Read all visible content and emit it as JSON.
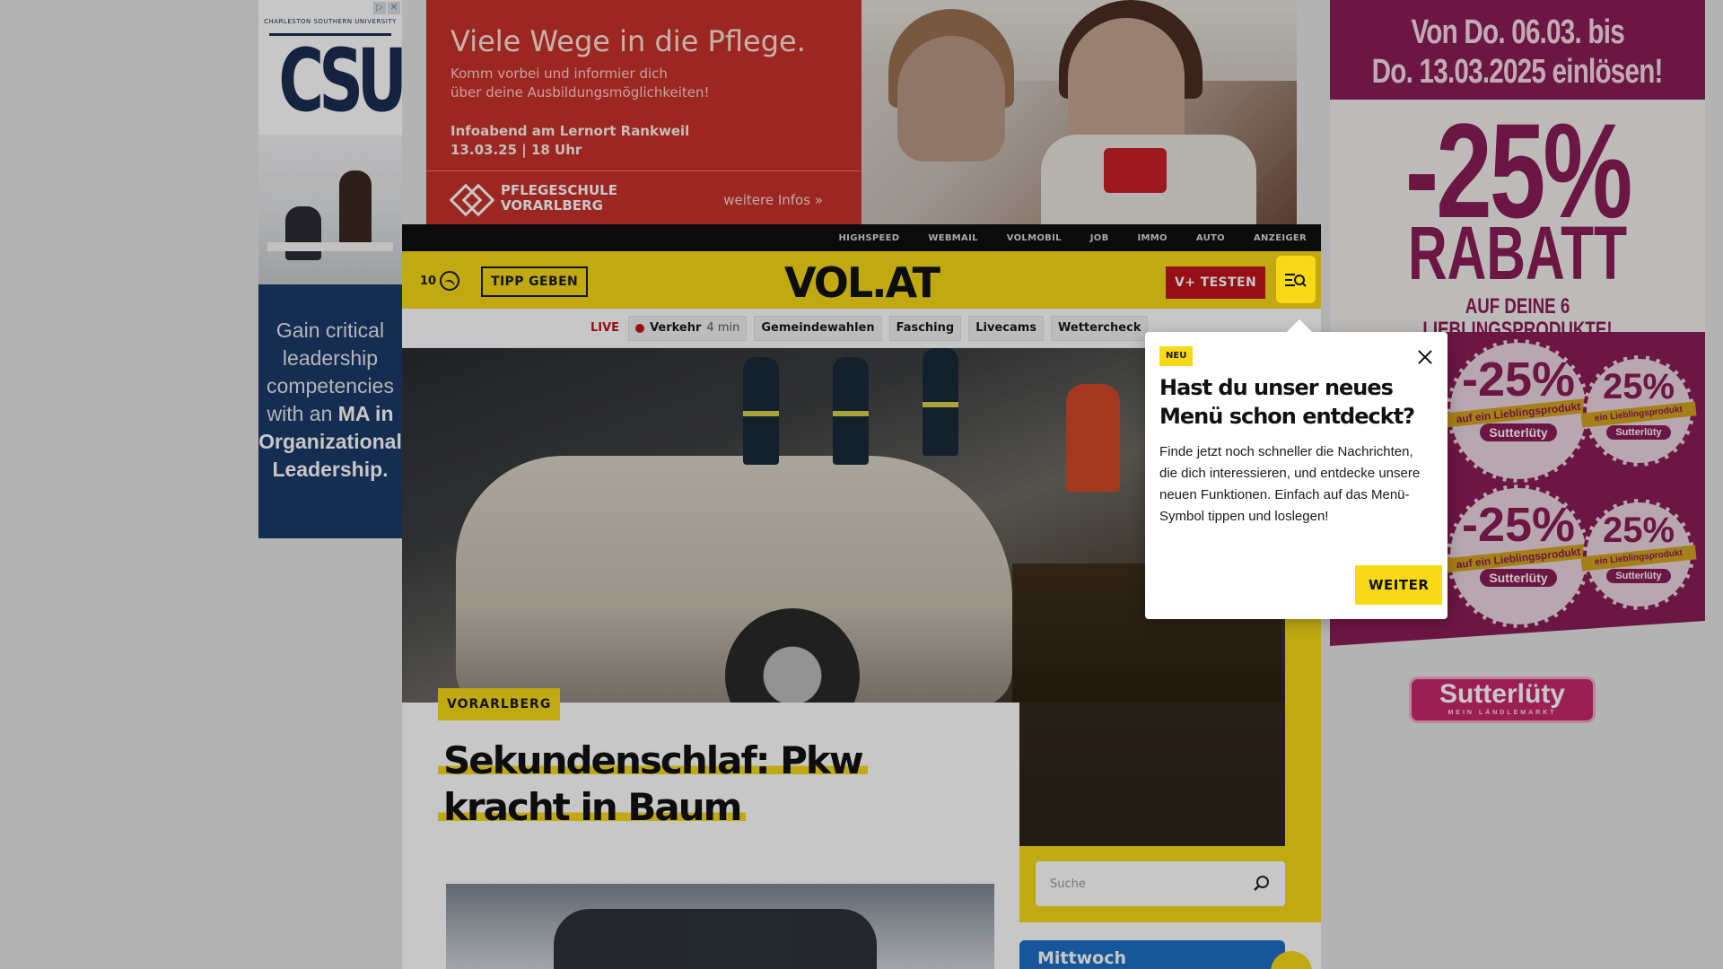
{
  "ads": {
    "left": {
      "university": "CHARLESTON SOUTHERN UNIVERSITY",
      "logo": "CSU",
      "copy_start": "Gain critical leadership competencies with an",
      "copy_bold": "MA in Organizational Leadership."
    },
    "top": {
      "headline": "Viele Wege in die Pflege.",
      "sub_line1": "Komm vorbei und informier dich",
      "sub_line2": "über deine Ausbildungsmöglichkeiten!",
      "event_line1": "Infoabend am Lernort Rankweil",
      "event_line2": "13.03.25 | 18 Uhr",
      "school_line1": "PFLEGESCHULE",
      "school_line2": "VORARLBERG",
      "more": "weitere Infos »"
    },
    "right": {
      "head_line1": "Von Do. 06.03. bis",
      "head_line2": "Do. 13.03.2025 einlösen!",
      "percent": "-25%",
      "rabatt": "RABATT",
      "lieblings": "AUF DEINE 6 LIEBLINGSPRODUKTE!",
      "sticker_pct": "-25%",
      "sticker_pct_small": "25%",
      "sticker_band": "auf ein Lieblingsprodukt",
      "sticker_band_small": "ein Lieblingsprodukt",
      "sticker_brand": "Sutterlüty",
      "brand": "Sutterlüty",
      "brand_tag": "MEIN LÄNDLEMARKT"
    }
  },
  "topbar": {
    "links": [
      "HIGHSPEED",
      "WEBMAIL",
      "VOLMOBIL",
      "JOB",
      "IMMO",
      "AUTO",
      "ANZEIGER"
    ]
  },
  "header": {
    "temperature": "10",
    "tipp_button": "TIPP GEBEN",
    "logo": "VOL.AT",
    "vplus_button": "V+ TESTEN"
  },
  "subnav": {
    "live_label": "LIVE",
    "verkehr": "Verkehr",
    "verkehr_min": "4 min",
    "chips": [
      "Gemeindewahlen",
      "Fasching",
      "Livecams",
      "Wettercheck"
    ]
  },
  "article": {
    "kicker": "VORARLBERG",
    "headline": "Sekundenschlaf: Pkw kracht in Baum"
  },
  "sidebar": {
    "search_placeholder": "Suche",
    "weather_day": "Mittwoch"
  },
  "tooltip": {
    "badge": "NEU",
    "title": "Hast du unser neues Menü schon entdeckt?",
    "body": "Finde jetzt noch schneller die Nachrichten, die dich interessieren, und entdecke unsere neuen Funktionen. Einfach auf das Menü-Symbol tippen und loslegen!",
    "button": "WEITER"
  },
  "colors": {
    "brand_yellow": "#f7d917",
    "live_red": "#c0141e",
    "ad_magenta": "#8b1d57"
  }
}
